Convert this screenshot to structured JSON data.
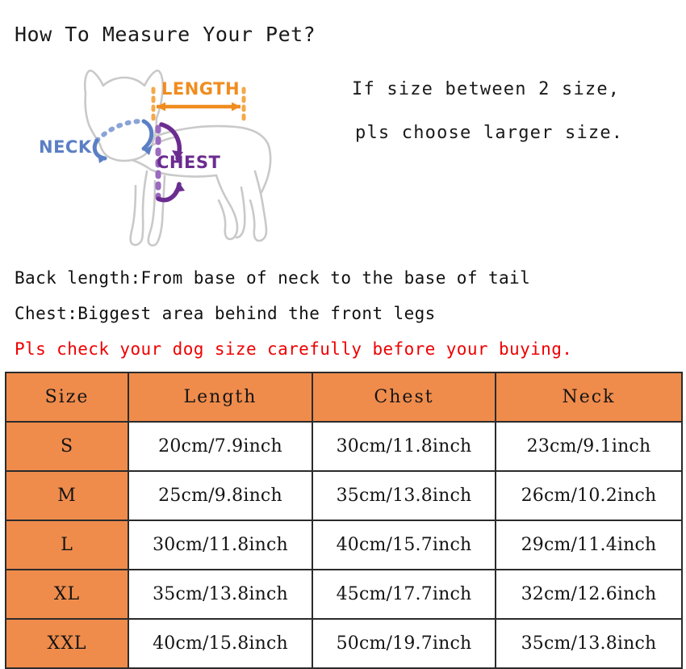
{
  "page": {
    "title": "How To Measure Your Pet?"
  },
  "note": {
    "line1": "If size between 2 size,",
    "line2": "pls choose larger size."
  },
  "diagram": {
    "labels": {
      "length": "LENGTH",
      "neck": "NECK",
      "chest": "CHEST"
    },
    "colors": {
      "length": "#F08C1E",
      "neck": "#5B7FC4",
      "chest": "#6B2C8F",
      "dog_outline": "#C9C9C9"
    }
  },
  "descriptions": {
    "back_length": "Back length:From base of neck to the base of tail",
    "chest": "Chest:Biggest area behind the front legs",
    "warning": "Pls check your dog size carefully before your buying."
  },
  "table": {
    "accent_color": "#EF8C4C",
    "headers": [
      "Size",
      "Length",
      "Chest",
      "Neck"
    ],
    "rows": [
      {
        "size": "S",
        "length": "20cm/7.9inch",
        "chest": "30cm/11.8inch",
        "neck": "23cm/9.1inch"
      },
      {
        "size": "M",
        "length": "25cm/9.8inch",
        "chest": "35cm/13.8inch",
        "neck": "26cm/10.2inch"
      },
      {
        "size": "L",
        "length": "30cm/11.8inch",
        "chest": "40cm/15.7inch",
        "neck": "29cm/11.4inch"
      },
      {
        "size": "XL",
        "length": "35cm/13.8inch",
        "chest": "45cm/17.7inch",
        "neck": "32cm/12.6inch"
      },
      {
        "size": "XXL",
        "length": "40cm/15.8inch",
        "chest": "50cm/19.7inch",
        "neck": "35cm/13.8inch"
      }
    ]
  }
}
